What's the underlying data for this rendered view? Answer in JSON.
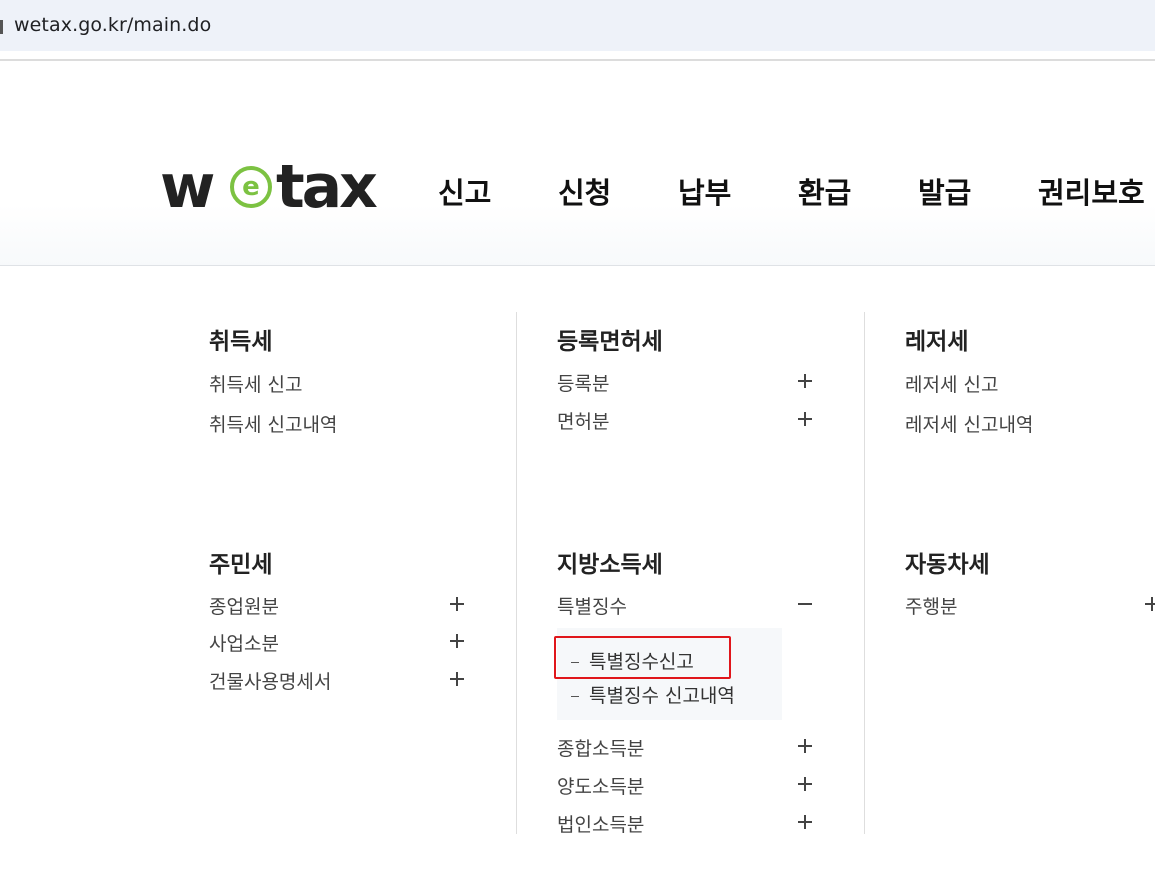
{
  "browser": {
    "url": "wetax.go.kr/main.do"
  },
  "logo": {
    "part1": "w",
    "part2": "e",
    "part3": "tax",
    "accent": "#7cc242"
  },
  "gnb": [
    "신고",
    "신청",
    "납부",
    "환급",
    "발급",
    "권리보호"
  ],
  "menu": {
    "acquisition": {
      "title": "취득세",
      "items": [
        "취득세 신고",
        "취득세 신고내역"
      ]
    },
    "registration": {
      "title": "등록면허세",
      "items": [
        "등록분",
        "면허분"
      ]
    },
    "leisure": {
      "title": "레저세",
      "items": [
        "레저세 신고",
        "레저세 신고내역"
      ]
    },
    "resident": {
      "title": "주민세",
      "items": [
        "종업원분",
        "사업소분",
        "건물사용명세서"
      ]
    },
    "local_income": {
      "title": "지방소득세",
      "items": [
        "특별징수",
        "종합소득분",
        "양도소득분",
        "법인소득분"
      ],
      "sub_items": [
        "특별징수신고",
        "특별징수 신고내역"
      ]
    },
    "vehicle": {
      "title": "자동차세",
      "items": [
        "주행분"
      ]
    }
  },
  "highlight_color": "#e0161b"
}
